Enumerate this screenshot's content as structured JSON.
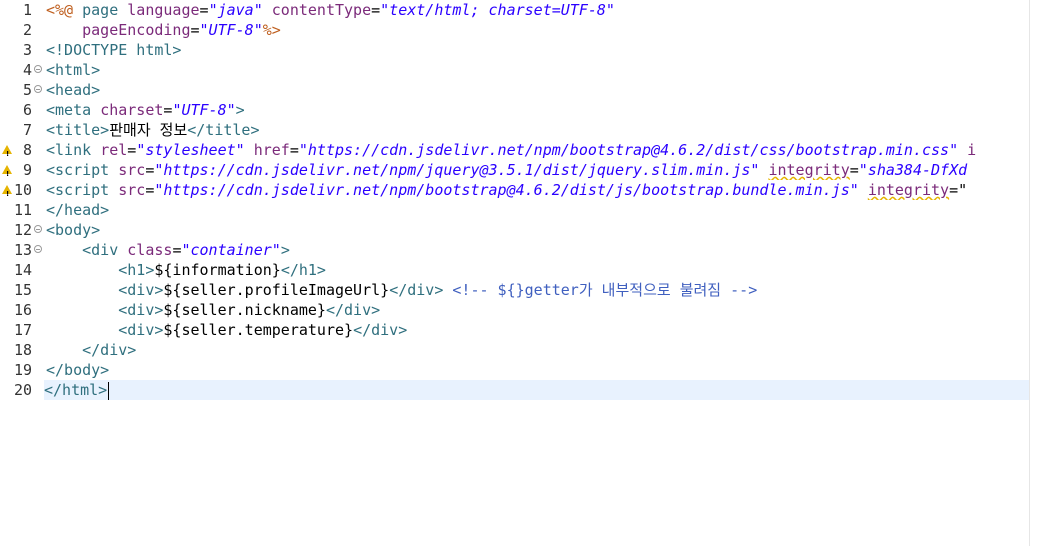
{
  "editor": {
    "lines": [
      {
        "num": "1",
        "fold": false,
        "warn": false,
        "parts": [
          {
            "t": "<%@",
            "c": "jsp"
          },
          {
            "t": " page ",
            "c": "tag"
          },
          {
            "t": "language",
            "c": "attr"
          },
          {
            "t": "=",
            "c": "txt"
          },
          {
            "t": "\"java\"",
            "c": "val"
          },
          {
            "t": " ",
            "c": "txt"
          },
          {
            "t": "contentType",
            "c": "attr"
          },
          {
            "t": "=",
            "c": "txt"
          },
          {
            "t": "\"text/html; charset=UTF-8\"",
            "c": "val"
          }
        ]
      },
      {
        "num": "2",
        "fold": false,
        "warn": false,
        "parts": [
          {
            "t": "    ",
            "c": "txt"
          },
          {
            "t": "pageEncoding",
            "c": "attr"
          },
          {
            "t": "=",
            "c": "txt"
          },
          {
            "t": "\"UTF-8\"",
            "c": "val"
          },
          {
            "t": "%>",
            "c": "jsp"
          }
        ]
      },
      {
        "num": "3",
        "fold": false,
        "warn": false,
        "parts": [
          {
            "t": "<!DOCTYPE html>",
            "c": "tag"
          }
        ]
      },
      {
        "num": "4",
        "fold": true,
        "warn": false,
        "parts": [
          {
            "t": "<html>",
            "c": "tag"
          }
        ]
      },
      {
        "num": "5",
        "fold": true,
        "warn": false,
        "parts": [
          {
            "t": "<head>",
            "c": "tag"
          }
        ]
      },
      {
        "num": "6",
        "fold": false,
        "warn": false,
        "parts": [
          {
            "t": "<meta ",
            "c": "tag"
          },
          {
            "t": "charset",
            "c": "attr"
          },
          {
            "t": "=",
            "c": "txt"
          },
          {
            "t": "\"UTF-8\"",
            "c": "val"
          },
          {
            "t": ">",
            "c": "tag"
          }
        ]
      },
      {
        "num": "7",
        "fold": false,
        "warn": false,
        "parts": [
          {
            "t": "<title>",
            "c": "tag"
          },
          {
            "t": "판매자 정보",
            "c": "txt"
          },
          {
            "t": "</title>",
            "c": "tag"
          }
        ]
      },
      {
        "num": "8",
        "fold": false,
        "warn": true,
        "parts": [
          {
            "t": "<link ",
            "c": "tag"
          },
          {
            "t": "rel",
            "c": "attr"
          },
          {
            "t": "=",
            "c": "txt"
          },
          {
            "t": "\"stylesheet\"",
            "c": "val"
          },
          {
            "t": " ",
            "c": "txt"
          },
          {
            "t": "href",
            "c": "attr"
          },
          {
            "t": "=",
            "c": "txt"
          },
          {
            "t": "\"https://cdn.jsdelivr.net/npm/bootstrap@4.6.2/dist/css/bootstrap.min.css\"",
            "c": "val"
          },
          {
            "t": " i",
            "c": "attr"
          }
        ]
      },
      {
        "num": "9",
        "fold": false,
        "warn": true,
        "parts": [
          {
            "t": "<script ",
            "c": "tag"
          },
          {
            "t": "src",
            "c": "attr"
          },
          {
            "t": "=",
            "c": "txt"
          },
          {
            "t": "\"https://cdn.jsdelivr.net/npm/jquery@3.5.1/dist/jquery.slim.min.js\"",
            "c": "val"
          },
          {
            "t": " ",
            "c": "txt"
          },
          {
            "t": "integrity",
            "c": "attr warnline"
          },
          {
            "t": "=",
            "c": "txt"
          },
          {
            "t": "\"sha384-DfXd",
            "c": "val"
          }
        ]
      },
      {
        "num": "10",
        "fold": false,
        "warn": true,
        "parts": [
          {
            "t": "<script ",
            "c": "tag"
          },
          {
            "t": "src",
            "c": "attr"
          },
          {
            "t": "=",
            "c": "txt"
          },
          {
            "t": "\"https://cdn.jsdelivr.net/npm/bootstrap@4.6.2/dist/js/bootstrap.bundle.min.js\"",
            "c": "val"
          },
          {
            "t": " ",
            "c": "txt"
          },
          {
            "t": "integrity",
            "c": "attr warnline"
          },
          {
            "t": "=\"",
            "c": "txt"
          }
        ]
      },
      {
        "num": "11",
        "fold": false,
        "warn": false,
        "parts": [
          {
            "t": "</head>",
            "c": "tag"
          }
        ]
      },
      {
        "num": "12",
        "fold": true,
        "warn": false,
        "parts": [
          {
            "t": "<body>",
            "c": "tag"
          }
        ]
      },
      {
        "num": "13",
        "fold": true,
        "warn": false,
        "parts": [
          {
            "t": "    ",
            "c": "txt"
          },
          {
            "t": "<div ",
            "c": "tag"
          },
          {
            "t": "class",
            "c": "attr"
          },
          {
            "t": "=",
            "c": "txt"
          },
          {
            "t": "\"container\"",
            "c": "val"
          },
          {
            "t": ">",
            "c": "tag"
          }
        ]
      },
      {
        "num": "14",
        "fold": false,
        "warn": false,
        "parts": [
          {
            "t": "        ",
            "c": "txt"
          },
          {
            "t": "<h1>",
            "c": "tag"
          },
          {
            "t": "${information}",
            "c": "txt"
          },
          {
            "t": "</h1>",
            "c": "tag"
          }
        ]
      },
      {
        "num": "15",
        "fold": false,
        "warn": false,
        "parts": [
          {
            "t": "        ",
            "c": "txt"
          },
          {
            "t": "<div>",
            "c": "tag"
          },
          {
            "t": "${seller.profileImageUrl}",
            "c": "txt"
          },
          {
            "t": "</div>",
            "c": "tag"
          },
          {
            "t": " ",
            "c": "txt"
          },
          {
            "t": "<!-- ${}getter가 내부적으로 불려짐 -->",
            "c": "cmt"
          }
        ]
      },
      {
        "num": "16",
        "fold": false,
        "warn": false,
        "parts": [
          {
            "t": "        ",
            "c": "txt"
          },
          {
            "t": "<div>",
            "c": "tag"
          },
          {
            "t": "${seller.nickname}",
            "c": "txt"
          },
          {
            "t": "</div>",
            "c": "tag"
          }
        ]
      },
      {
        "num": "17",
        "fold": false,
        "warn": false,
        "parts": [
          {
            "t": "        ",
            "c": "txt"
          },
          {
            "t": "<div>",
            "c": "tag"
          },
          {
            "t": "${seller.temperature}",
            "c": "txt"
          },
          {
            "t": "</div>",
            "c": "tag"
          }
        ]
      },
      {
        "num": "18",
        "fold": false,
        "warn": false,
        "parts": [
          {
            "t": "    ",
            "c": "txt"
          },
          {
            "t": "</div>",
            "c": "tag"
          }
        ]
      },
      {
        "num": "19",
        "fold": false,
        "warn": false,
        "parts": [
          {
            "t": "</body>",
            "c": "tag"
          }
        ]
      },
      {
        "num": "20",
        "fold": false,
        "warn": false,
        "active": true,
        "parts": [
          {
            "t": "</html>",
            "c": "tag"
          }
        ]
      }
    ],
    "colors": {
      "tag": "#2f6f7e",
      "attribute": "#7b2a7a",
      "value": "#2a00ff",
      "jsp": "#bf5f1f",
      "comment": "#3f5fbf",
      "active_line": "#e8f2fe",
      "warning": "#e6b400"
    },
    "icons": {
      "fold": "collapse-fold-icon",
      "warning": "warning-triangle-icon"
    }
  }
}
